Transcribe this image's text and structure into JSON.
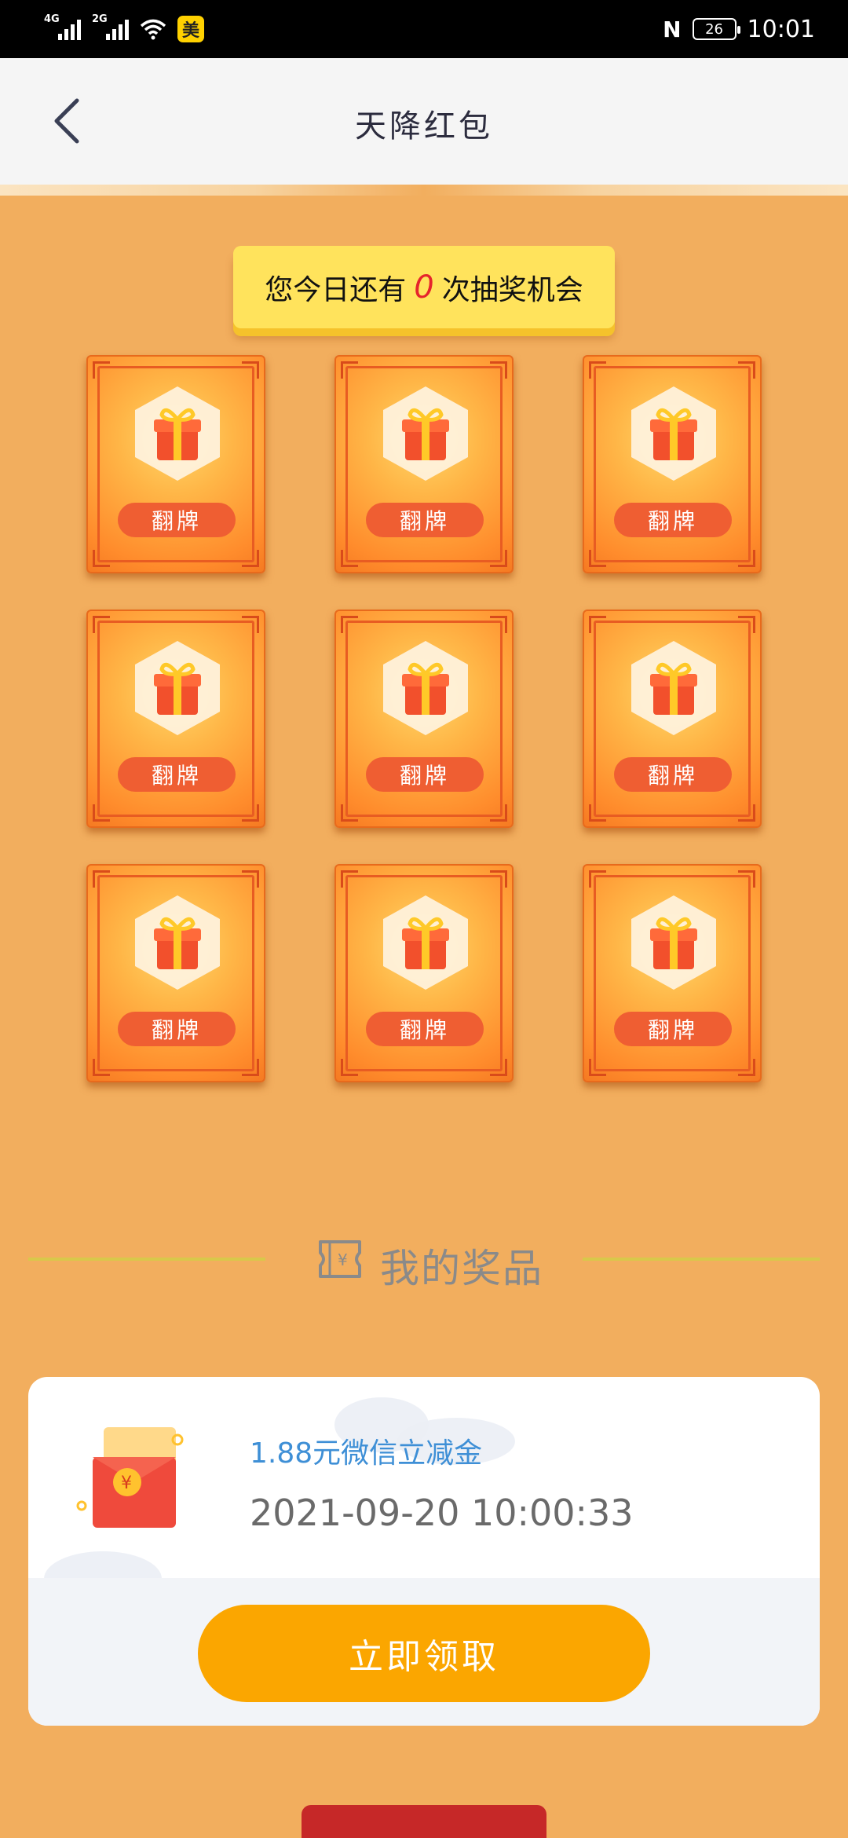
{
  "status_bar": {
    "signal_1_label": "4G",
    "signal_2_label": "2G",
    "app_badge": "美",
    "nfc": "N",
    "battery": "26",
    "time": "10:01"
  },
  "nav": {
    "title": "天降红包"
  },
  "chance": {
    "prefix": "您今日还有",
    "count": "0",
    "suffix": "次抽奖机会"
  },
  "cards": [
    {
      "label": "翻牌"
    },
    {
      "label": "翻牌"
    },
    {
      "label": "翻牌"
    },
    {
      "label": "翻牌"
    },
    {
      "label": "翻牌"
    },
    {
      "label": "翻牌"
    },
    {
      "label": "翻牌"
    },
    {
      "label": "翻牌"
    },
    {
      "label": "翻牌"
    }
  ],
  "prizes": {
    "title": "我的奖品",
    "items": [
      {
        "name": "1.88元微信立减金",
        "time": "2021-09-20 10:00:33",
        "button": "立即领取"
      }
    ]
  },
  "colors": {
    "page_bg": "#f2ae5e",
    "banner": "#ffe35c",
    "flip_button": "#ef5e32",
    "claim_button": "#fba600",
    "prize_name": "#3e8fd6"
  }
}
